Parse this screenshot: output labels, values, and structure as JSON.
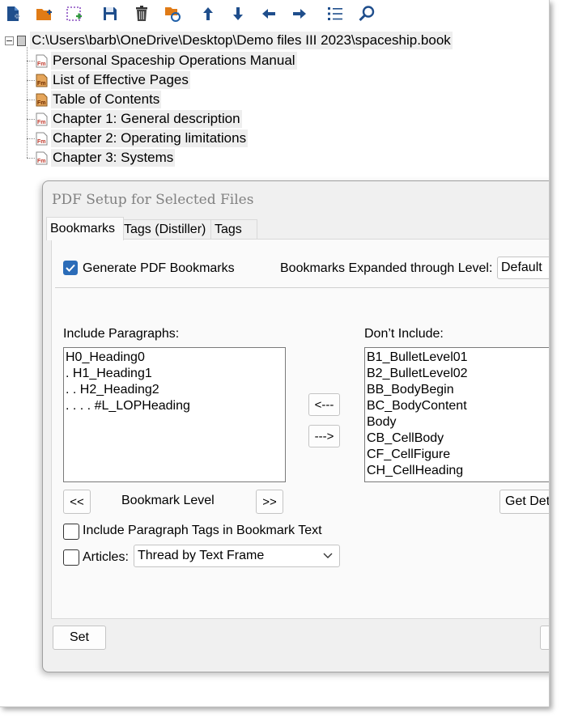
{
  "toolbar": {
    "buttons": [
      "new-file-icon",
      "new-folder-icon",
      "add-selection-icon",
      "save-icon",
      "delete-icon",
      "refresh-folder-icon",
      "move-up-icon",
      "move-down-icon",
      "move-left-icon",
      "move-right-icon",
      "list-icon",
      "search-icon"
    ]
  },
  "tree": {
    "root": "C:\\Users\\barb\\OneDrive\\Desktop\\Demo files III 2023\\spaceship.book",
    "items": [
      "Personal Spaceship Operations Manual",
      "List of Effective Pages",
      "Table of Contents",
      "Chapter 1: General description",
      "Chapter 2: Operating limitations",
      "Chapter 3: Systems"
    ]
  },
  "dialog": {
    "title": "PDF Setup for Selected Files",
    "tabs": [
      "Bookmarks",
      "Tags (Distiller)",
      "Tags"
    ],
    "generate_label": "Generate PDF Bookmarks",
    "generate_checked": true,
    "expanded_label": "Bookmarks Expanded through Level:",
    "expanded_value": "Default",
    "include_label": "Include Paragraphs:",
    "include_items": [
      "H0_Heading0",
      ". H1_Heading1",
      ". . H2_Heading2",
      ". . . . #L_LOPHeading"
    ],
    "dont_include_label": "Don’t Include:",
    "dont_include_items": [
      "B1_BulletLevel01",
      "B2_BulletLevel02",
      "BB_BodyBegin",
      "BC_BodyContent",
      "Body",
      "CB_CellBody",
      "CF_CellFigure",
      "CH_CellHeading"
    ],
    "move_left": "<---",
    "move_right": "--->",
    "level_down": "<<",
    "level_label": "Bookmark Level",
    "level_up": ">>",
    "get_defaults": "Get Det",
    "include_tags_label": "Include Paragraph Tags in Bookmark Text",
    "articles_label": "Articles:",
    "articles_value": "Thread by Text Frame",
    "set_button": "Set"
  },
  "colors": {
    "accent": "#2b6cb8",
    "icon_blue": "#1f5fa8",
    "icon_orange": "#e07b16"
  }
}
